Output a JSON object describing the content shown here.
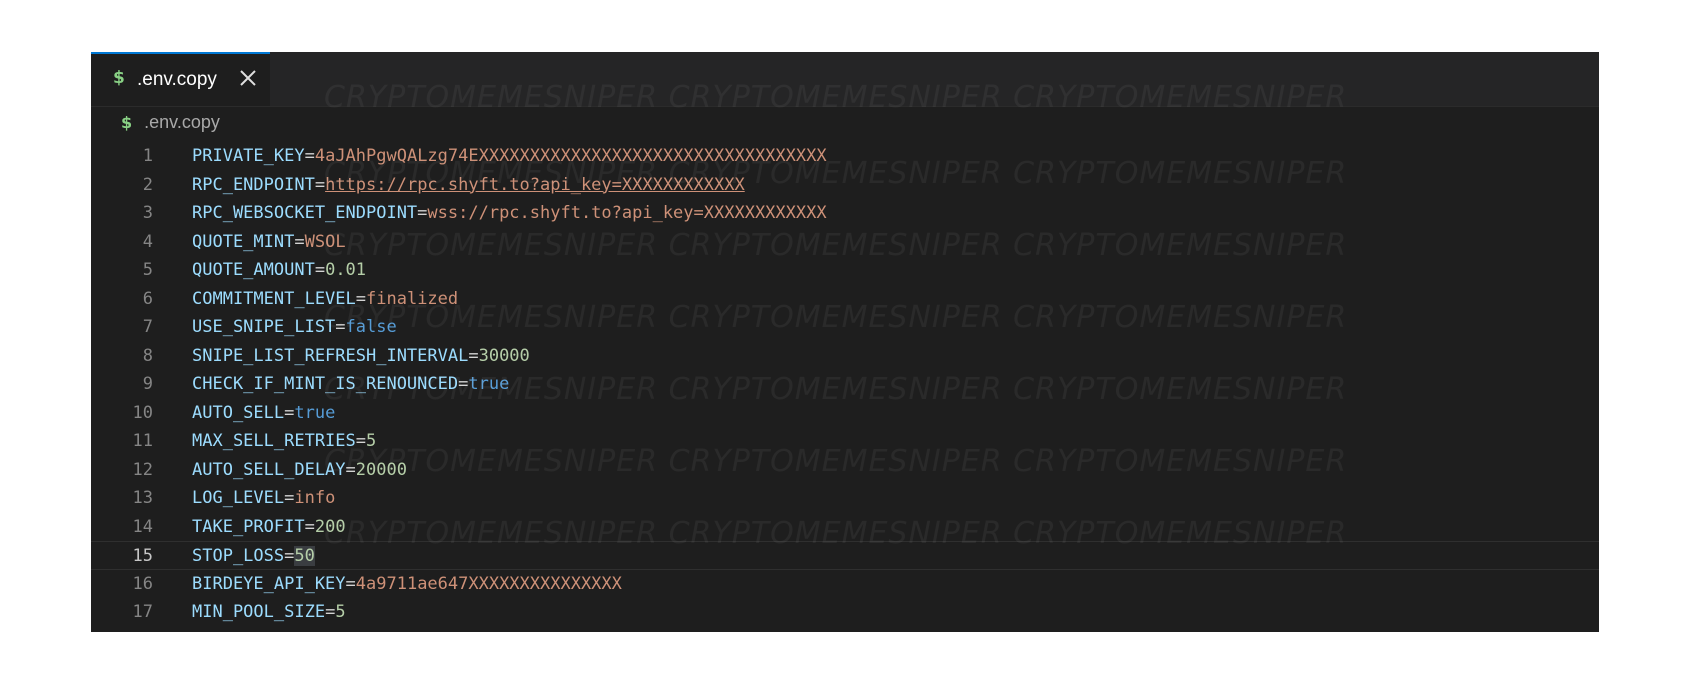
{
  "tab": {
    "label": ".env.copy",
    "icon": "dollar-sign-icon",
    "icon_glyph": "$"
  },
  "breadcrumb": {
    "label": ".env.copy",
    "icon_glyph": "$"
  },
  "watermark_text": "CRYPTOMEMESNIPER CRYPTOMEMESNIPER CRYPTOMEMESNIPER",
  "current_line": 15,
  "lines": [
    {
      "n": "1",
      "key": "PRIVATE_KEY",
      "value": "4aJAhPgwQALzg74EXXXXXXXXXXXXXXXXXXXXXXXXXXXXXXXXXX",
      "type": "str"
    },
    {
      "n": "2",
      "key": "RPC_ENDPOINT",
      "value": "https://rpc.shyft.to?api_key=XXXXXXXXXXXX",
      "type": "link"
    },
    {
      "n": "3",
      "key": "RPC_WEBSOCKET_ENDPOINT",
      "value": "wss://rpc.shyft.to?api_key=XXXXXXXXXXXX",
      "type": "str"
    },
    {
      "n": "4",
      "key": "QUOTE_MINT",
      "value": "WSOL",
      "type": "str"
    },
    {
      "n": "5",
      "key": "QUOTE_AMOUNT",
      "value": "0.01",
      "type": "num"
    },
    {
      "n": "6",
      "key": "COMMITMENT_LEVEL",
      "value": "finalized",
      "type": "str"
    },
    {
      "n": "7",
      "key": "USE_SNIPE_LIST",
      "value": "false",
      "type": "bool"
    },
    {
      "n": "8",
      "key": "SNIPE_LIST_REFRESH_INTERVAL",
      "value": "30000",
      "type": "num"
    },
    {
      "n": "9",
      "key": "CHECK_IF_MINT_IS_RENOUNCED",
      "value": "true",
      "type": "bool"
    },
    {
      "n": "10",
      "key": "AUTO_SELL",
      "value": "true",
      "type": "bool"
    },
    {
      "n": "11",
      "key": "MAX_SELL_RETRIES",
      "value": "5",
      "type": "num"
    },
    {
      "n": "12",
      "key": "AUTO_SELL_DELAY",
      "value": "20000",
      "type": "num"
    },
    {
      "n": "13",
      "key": "LOG_LEVEL",
      "value": "info",
      "type": "str"
    },
    {
      "n": "14",
      "key": "TAKE_PROFIT",
      "value": "200",
      "type": "num"
    },
    {
      "n": "15",
      "key": "STOP_LOSS",
      "value": "50",
      "type": "num"
    },
    {
      "n": "16",
      "key": "BIRDEYE_API_KEY",
      "value": "4a9711ae647XXXXXXXXXXXXXXX",
      "type": "str"
    },
    {
      "n": "17",
      "key": "MIN_POOL_SIZE",
      "value": "5",
      "type": "num"
    }
  ],
  "colors": {
    "editor_bg": "#1e1e1e",
    "key": "#9cdcfe",
    "string": "#ce9178",
    "number": "#b5cea8",
    "boolean": "#569cd6",
    "tab_accent": "#0078d4",
    "dollar_icon": "#89d185"
  }
}
